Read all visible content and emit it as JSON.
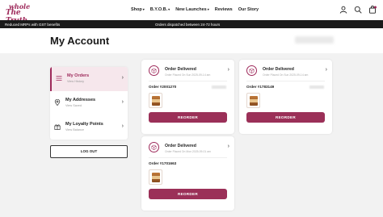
{
  "brand": {
    "logo_line1": "whole",
    "logo_line2": "The Truth"
  },
  "nav": [
    {
      "label": "Shop",
      "has_caret": true
    },
    {
      "label": "B.Y.O.B.",
      "has_caret": true
    },
    {
      "label": "New Launches",
      "has_caret": true
    },
    {
      "label": "Reviews",
      "has_caret": false
    },
    {
      "label": "Our Story",
      "has_caret": false
    }
  ],
  "header_icons": [
    "user-icon",
    "search-icon",
    "cart-icon"
  ],
  "promo": {
    "left": "Reduced MRPs with GST benefits",
    "center": "Orders dispatched between 24-72 hours"
  },
  "page_title": "My Account",
  "sidebar": {
    "items": [
      {
        "label": "My Orders",
        "sub": "View History",
        "icon": "list-icon",
        "active": true
      },
      {
        "label": "My Addresses",
        "sub": "View Saved",
        "icon": "location-pin-icon",
        "active": false
      },
      {
        "label": "My Loyalty Points",
        "sub": "View Balance",
        "icon": "gift-icon",
        "active": false
      }
    ],
    "logout_label": "LOG OUT"
  },
  "orders": [
    {
      "status": "Order Delivered",
      "sub": "Order Placed On Sun 2025-09-14 am",
      "order_id": "Order #2001270",
      "reorder_label": "REORDER"
    },
    {
      "status": "Order Delivered",
      "sub": "Order Placed On Sun 2025-09-14 am",
      "order_id": "Order #1783149",
      "reorder_label": "REORDER"
    },
    {
      "status": "Order Delivered",
      "sub": "Order Placed On Mon 2025-09-01 am",
      "order_id": "Order #1701663",
      "reorder_label": "REORDER"
    }
  ],
  "colors": {
    "accent": "#9e2a5b",
    "button": "#9b3058",
    "promo_bg": "#1a1a1a",
    "body_bg": "#f2f2f2",
    "active_bg": "#f6e7ec"
  }
}
